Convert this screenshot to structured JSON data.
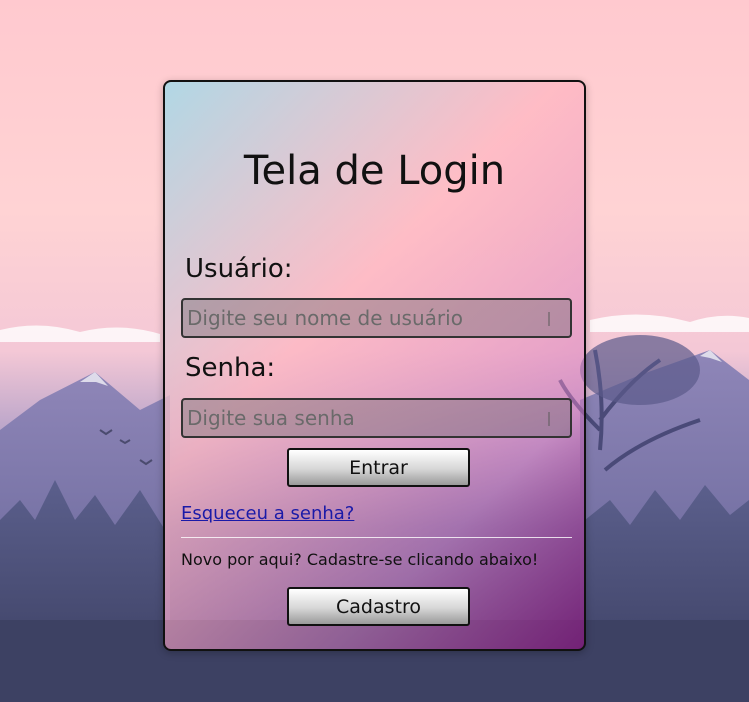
{
  "login": {
    "title": "Tela de Login",
    "username_label": "Usuário:",
    "username_placeholder": "Digite seu nome de usuário",
    "password_label": "Senha:",
    "password_placeholder": "Digite sua senha",
    "submit_label": "Entrar",
    "forgot_link": "Esqueceu a senha?",
    "signup_prompt": "Novo por aqui? Cadastre-se clicando abaixo!",
    "signup_label": "Cadastro"
  },
  "colors": {
    "link": "#1a1aa8",
    "card_border": "#111111"
  }
}
